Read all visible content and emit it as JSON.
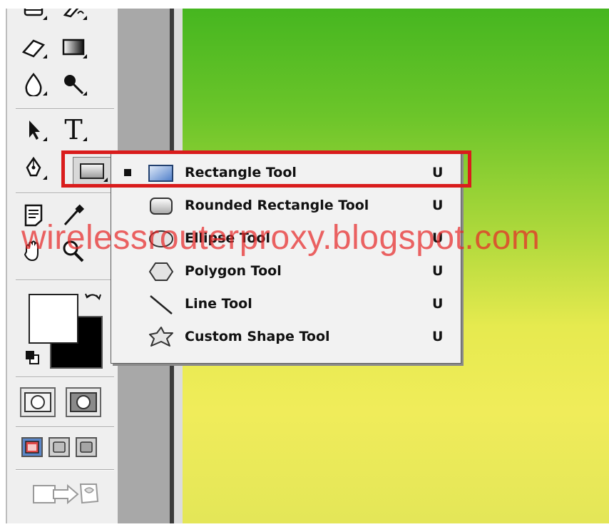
{
  "menu": {
    "items": [
      {
        "label": "Rectangle Tool",
        "shortcut": "U",
        "icon": "rectangle-icon",
        "selected": true
      },
      {
        "label": "Rounded Rectangle Tool",
        "shortcut": "U",
        "icon": "rounded-rectangle-icon",
        "selected": false
      },
      {
        "label": "Ellipse Tool",
        "shortcut": "U",
        "icon": "ellipse-icon",
        "selected": false
      },
      {
        "label": "Polygon Tool",
        "shortcut": "U",
        "icon": "polygon-icon",
        "selected": false
      },
      {
        "label": "Line Tool",
        "shortcut": "U",
        "icon": "line-icon",
        "selected": false
      },
      {
        "label": "Custom Shape Tool",
        "shortcut": "U",
        "icon": "custom-shape-icon",
        "selected": false
      }
    ]
  },
  "toolbox": {
    "type_tool_glyph": "T",
    "foreground_color": "#ffffff",
    "background_color": "#000000"
  },
  "watermark": {
    "text": "wirelessrouterproxy.blogspot.com"
  },
  "colors": {
    "highlight": "#d91c1c",
    "canvas_top": "#43b51f",
    "canvas_bottom": "#e3e658"
  }
}
